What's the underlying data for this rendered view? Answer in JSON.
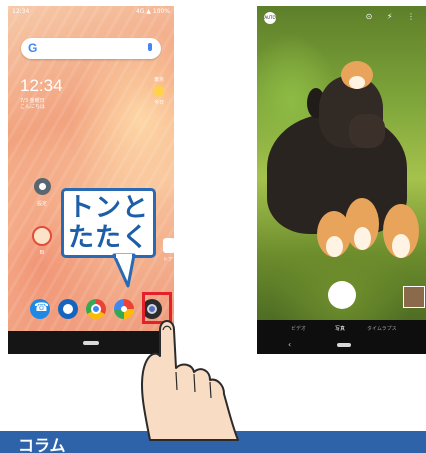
{
  "home_screen": {
    "status_bar": {
      "time": "12:34",
      "right": "4G ▲ 100%"
    },
    "search_bar": {
      "logo": "G"
    },
    "clock": {
      "time": "12:34",
      "date": "7/3 金曜日",
      "greeting": "こんにちは"
    },
    "weather": {
      "location": "東京",
      "day": "今日"
    },
    "apps": {
      "settings_label": "設定",
      "face_label": "BI",
      "store_label": "トア"
    },
    "dock": [
      "phone-icon",
      "message-icon",
      "chrome-icon",
      "photos-icon",
      "camera-icon"
    ]
  },
  "callout": {
    "line1": "トンと",
    "line2": "たたく"
  },
  "camera_screen": {
    "auto_label": "AUTO",
    "top_icons": "⊙ ⚡ ⋮",
    "modes": {
      "video": "ビデオ",
      "photo": "写真",
      "timelapse": "タイムラプス"
    },
    "back_symbol": "‹"
  },
  "column_header": {
    "title": "コラム"
  },
  "colors": {
    "accent_blue": "#2a6ab3",
    "highlight_red": "#e5202a",
    "column_bar": "#2e63aa"
  }
}
